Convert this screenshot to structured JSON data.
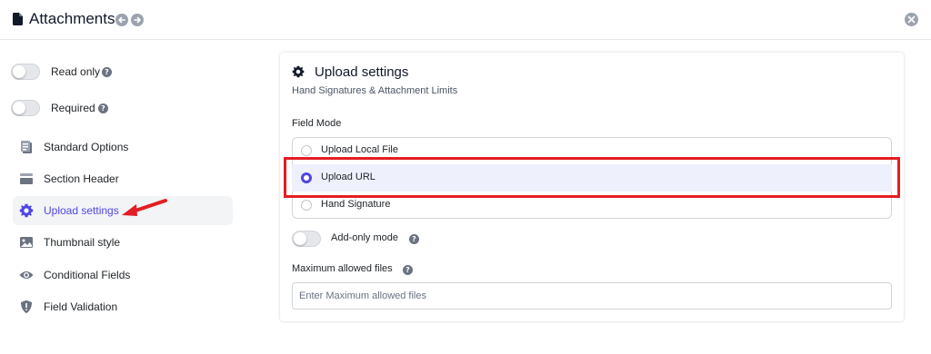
{
  "header": {
    "title": "Attachments"
  },
  "sidebar": {
    "toggles": [
      {
        "label": "Read only"
      },
      {
        "label": "Required"
      }
    ],
    "items": [
      {
        "label": "Standard Options",
        "icon": "clipboard-icon"
      },
      {
        "label": "Section Header",
        "icon": "section-header-icon"
      },
      {
        "label": "Upload settings",
        "icon": "gear-icon",
        "active": true
      },
      {
        "label": "Thumbnail style",
        "icon": "image-icon"
      },
      {
        "label": "Conditional Fields",
        "icon": "eye-icon"
      },
      {
        "label": "Field Validation",
        "icon": "shield-icon"
      }
    ]
  },
  "panel": {
    "title": "Upload settings",
    "subtitle": "Hand Signatures & Attachment Limits",
    "field_mode_label": "Field Mode",
    "options": [
      {
        "label": "Upload Local File",
        "selected": false
      },
      {
        "label": "Upload URL",
        "selected": true
      },
      {
        "label": "Hand Signature",
        "selected": false
      }
    ],
    "add_only_label": "Add-only mode",
    "max_files_label": "Maximum allowed files",
    "max_files_placeholder": "Enter Maximum allowed files",
    "max_files_value": ""
  },
  "colors": {
    "accent": "#4f46e5",
    "highlight": "#e31e24",
    "selected_row": "#eef0fb"
  }
}
